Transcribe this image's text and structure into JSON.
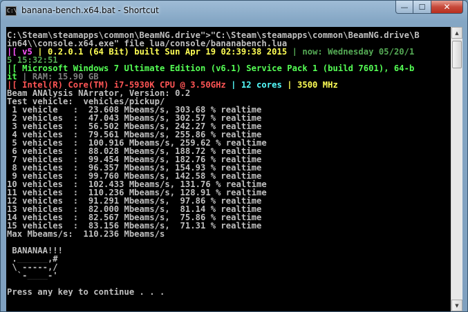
{
  "window": {
    "title": "banana-bench.x64.bat - Shortcut",
    "icon_text": "C:\\",
    "controls": {
      "minimize": "—",
      "maximize": "☐",
      "close": "✕"
    }
  },
  "console": {
    "lines": [
      [
        {
          "t": "C:\\Steam\\steamapps\\common\\BeamNG.drive\">\"C:\\Steam\\steamapps\\common\\BeamNG.drive\\B",
          "c": "default"
        }
      ],
      [
        {
          "t": "in64\\\\console.x64.exe\" file lua/console/bananabench.lua",
          "c": "default"
        }
      ],
      [
        {
          "t": "|[ v5 ",
          "c": "pink"
        },
        {
          "t": "| 0.2.0.1 (64 Bit) built Sun Apr 19 02:39:38 2015 ",
          "c": "yellow"
        },
        {
          "t": "| now: Wednesday 05/20/1",
          "c": "olivegreen"
        }
      ],
      [
        {
          "t": "5 15:32:51",
          "c": "olivegreen"
        }
      ],
      [
        {
          "t": "|[ Microsoft Windows 7 Ultimate Edition (v6.1) Service Pack 1 (build 7601), 64-b",
          "c": "green"
        }
      ],
      [
        {
          "t": "it ",
          "c": "green"
        },
        {
          "t": "| RAM: 15.90 GB",
          "c": "grey"
        }
      ],
      [
        {
          "t": "|[ Intel(R) Core(TM) i7-5930K CPU @ 3.50GHz ",
          "c": "red"
        },
        {
          "t": "| 12 cores ",
          "c": "cyan"
        },
        {
          "t": "| 3500 MHz",
          "c": "yellow"
        }
      ],
      [
        {
          "t": "Beam ANAlysis NArrator, Version: 0.2",
          "c": "default"
        }
      ],
      [
        {
          "t": "Test vehicle:  vehicles/pickup/",
          "c": "default"
        }
      ],
      [
        {
          "t": " 1 vehicle   :  23.608 Mbeams/s, 303.68 % realtime",
          "c": "default"
        }
      ],
      [
        {
          "t": " 2 vehicles  :  47.043 Mbeams/s, 302.57 % realtime",
          "c": "default"
        }
      ],
      [
        {
          "t": " 3 vehicles  :  56.502 Mbeams/s, 242.27 % realtime",
          "c": "default"
        }
      ],
      [
        {
          "t": " 4 vehicles  :  79.561 Mbeams/s, 255.86 % realtime",
          "c": "default"
        }
      ],
      [
        {
          "t": " 5 vehicles  :  100.916 Mbeams/s, 259.62 % realtime",
          "c": "default"
        }
      ],
      [
        {
          "t": " 6 vehicles  :  88.028 Mbeams/s, 188.72 % realtime",
          "c": "default"
        }
      ],
      [
        {
          "t": " 7 vehicles  :  99.454 Mbeams/s, 182.76 % realtime",
          "c": "default"
        }
      ],
      [
        {
          "t": " 8 vehicles  :  96.357 Mbeams/s, 154.93 % realtime",
          "c": "default"
        }
      ],
      [
        {
          "t": " 9 vehicles  :  99.760 Mbeams/s, 142.58 % realtime",
          "c": "default"
        }
      ],
      [
        {
          "t": "10 vehicles  :  102.433 Mbeams/s, 131.76 % realtime",
          "c": "default"
        }
      ],
      [
        {
          "t": "11 vehicles  :  110.236 Mbeams/s, 128.91 % realtime",
          "c": "default"
        }
      ],
      [
        {
          "t": "12 vehicles  :  91.291 Mbeams/s,  97.86 % realtime",
          "c": "default"
        }
      ],
      [
        {
          "t": "13 vehicles  :  82.000 Mbeams/s,  81.14 % realtime",
          "c": "default"
        }
      ],
      [
        {
          "t": "14 vehicles  :  82.567 Mbeams/s,  75.86 % realtime",
          "c": "default"
        }
      ],
      [
        {
          "t": "15 vehicles  :  83.156 Mbeams/s,  71.31 % realtime",
          "c": "default"
        }
      ],
      [
        {
          "t": "Max Mbeams/s:  110.236 Mbeams/s",
          "c": "default"
        }
      ],
      [
        {
          "t": "",
          "c": "default"
        }
      ],
      [
        {
          "t": " BANANAA!!!",
          "c": "default"
        }
      ],
      [
        {
          "t": " .______,#",
          "c": "default"
        }
      ],
      [
        {
          "t": " \\ -----,/",
          "c": "default"
        }
      ],
      [
        {
          "t": "  `-____-'",
          "c": "default"
        }
      ],
      [
        {
          "t": "",
          "c": "default"
        }
      ],
      [
        {
          "t": "Press any key to continue . . .",
          "c": "default"
        }
      ]
    ]
  },
  "scrollbar": {
    "up_arrow": "▲",
    "down_arrow": "▼"
  }
}
